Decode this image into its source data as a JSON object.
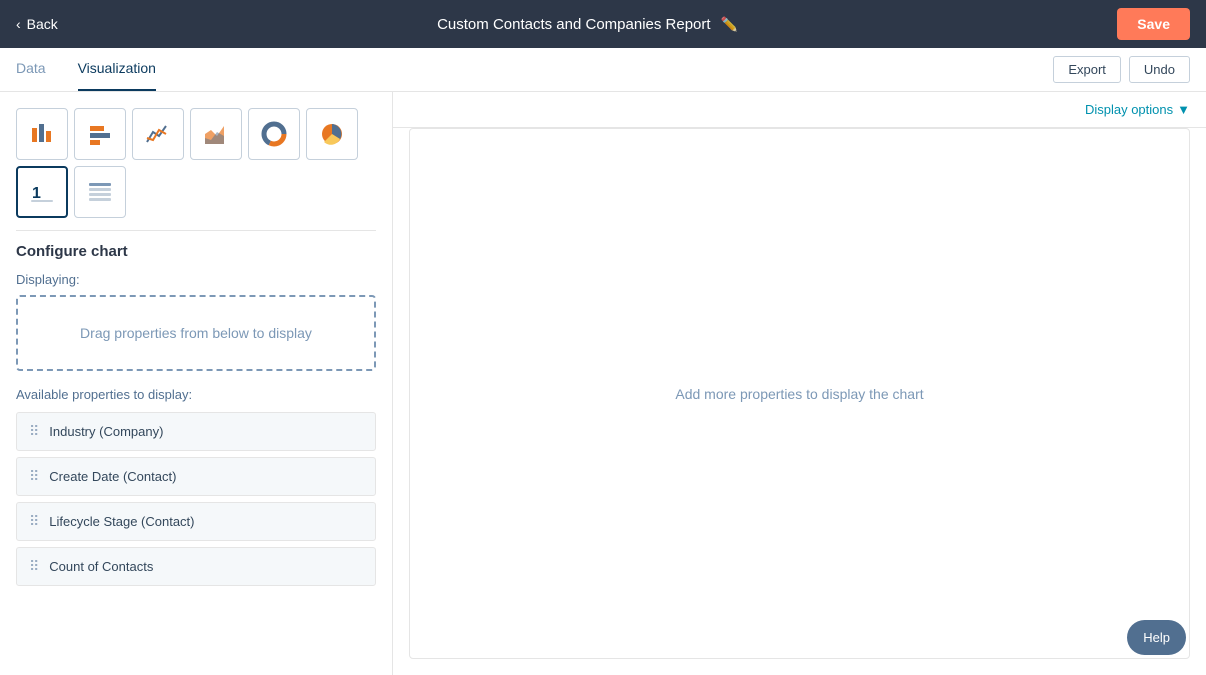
{
  "topBar": {
    "backLabel": "Back",
    "title": "Custom Contacts and Companies Report",
    "saveLabel": "Save"
  },
  "tabs": {
    "items": [
      {
        "label": "Data",
        "active": false
      },
      {
        "label": "Visualization",
        "active": true
      }
    ],
    "exportLabel": "Export",
    "undoLabel": "Undo"
  },
  "sidebar": {
    "configureChartLabel": "Configure chart",
    "displayingLabel": "Displaying:",
    "dropZoneText": "Drag properties from below to display",
    "availableLabel": "Available properties to display:",
    "properties": [
      {
        "label": "Industry (Company)"
      },
      {
        "label": "Create Date (Contact)"
      },
      {
        "label": "Lifecycle Stage (Contact)"
      },
      {
        "label": "Count of Contacts"
      }
    ],
    "chartTypes": [
      {
        "name": "bar-chart",
        "title": "Bar chart"
      },
      {
        "name": "column-chart",
        "title": "Column chart"
      },
      {
        "name": "line-chart",
        "title": "Line chart"
      },
      {
        "name": "area-chart",
        "title": "Area chart"
      },
      {
        "name": "donut-chart",
        "title": "Donut chart"
      },
      {
        "name": "pie-chart",
        "title": "Pie chart"
      },
      {
        "name": "number-chart",
        "title": "Number/Single stat",
        "selected": true
      },
      {
        "name": "table-chart",
        "title": "Table"
      }
    ]
  },
  "mainContent": {
    "displayOptionsLabel": "Display options",
    "chartEmptyText": "Add more properties to display the chart"
  },
  "helpBtn": {
    "label": "Help"
  }
}
